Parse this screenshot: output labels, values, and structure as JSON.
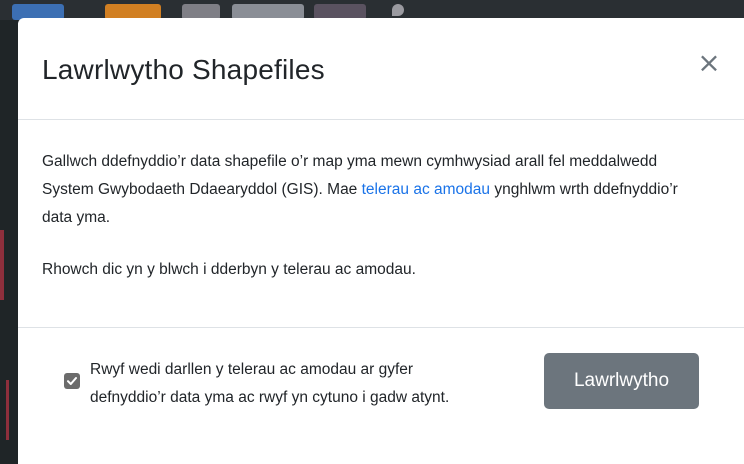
{
  "modal": {
    "title": "Lawrlwytho Shapefiles",
    "close_label": "×",
    "body": {
      "paragraph1_before_link": "Gallwch ddefnyddio’r data shapefile o’r map yma mewn cymhwysiad arall fel meddalwedd System Gwybodaeth Ddaearyddol (GIS). Mae ",
      "link_text": "telerau ac amodau",
      "paragraph1_after_link": " ynghlwm wrth ddefnyddio’r data yma.",
      "paragraph2": "Rhowch dic yn y blwch i dderbyn y telerau ac amodau."
    },
    "footer": {
      "consent_checked": true,
      "consent_label": "Rwyf wedi darllen y telerau ac amodau ar gyfer defnyddio’r data yma ac rwyf yn cytuno i gadw atynt.",
      "download_button_label": "Lawrlwytho"
    }
  },
  "colors": {
    "link": "#1a73e8",
    "button_bg": "#6c757d",
    "checkbox_bg": "#6c6c6c",
    "overlay": "#2b2a2a"
  },
  "icons": {
    "close": "close-icon",
    "checkbox": "checkmark-icon"
  }
}
